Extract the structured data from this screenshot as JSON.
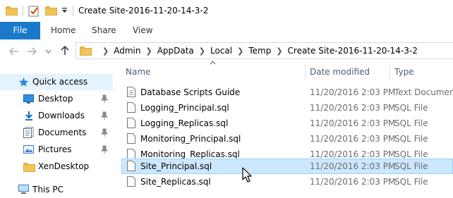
{
  "window": {
    "title": "Create Site-2016-11-20-14-3-2"
  },
  "ribbon": {
    "tabs": [
      "File",
      "Home",
      "Share",
      "View"
    ],
    "accent": "#1979ca"
  },
  "address": {
    "crumbs": [
      "Admin",
      "AppData",
      "Local",
      "Temp",
      "Create Site-2016-11-20-14-3-2"
    ]
  },
  "sidebar": {
    "items": [
      {
        "label": "Quick access",
        "icon": "star-icon",
        "pinned": false
      },
      {
        "label": "Desktop",
        "icon": "desktop-icon",
        "pinned": true
      },
      {
        "label": "Downloads",
        "icon": "download-icon",
        "pinned": true
      },
      {
        "label": "Documents",
        "icon": "documents-icon",
        "pinned": true
      },
      {
        "label": "Pictures",
        "icon": "pictures-icon",
        "pinned": true
      },
      {
        "label": "XenDesktop",
        "icon": "folder-icon",
        "pinned": false
      },
      {
        "label": "This PC",
        "icon": "computer-icon",
        "pinned": false
      }
    ]
  },
  "files": {
    "columns": [
      "Name",
      "Date modified",
      "Type"
    ],
    "rows": [
      {
        "name": "Database Scripts Guide",
        "date": "11/20/2016 2:03 PM",
        "type": "Text Document"
      },
      {
        "name": "Logging_Principal.sql",
        "date": "11/20/2016 2:03 PM",
        "type": "SQL File"
      },
      {
        "name": "Logging_Replicas.sql",
        "date": "11/20/2016 2:03 PM",
        "type": "SQL File"
      },
      {
        "name": "Monitoring_Principal.sql",
        "date": "11/20/2016 2:03 PM",
        "type": "SQL File"
      },
      {
        "name": "Monitoring_Replicas.sql",
        "date": "11/20/2016 2:03 PM",
        "type": "SQL File"
      },
      {
        "name": "Site_Principal.sql",
        "date": "11/20/2016 2:03 PM",
        "type": "SQL File"
      },
      {
        "name": "Site_Replicas.sql",
        "date": "11/20/2016 2:03 PM",
        "type": "SQL File"
      }
    ],
    "selected_index": 5
  }
}
